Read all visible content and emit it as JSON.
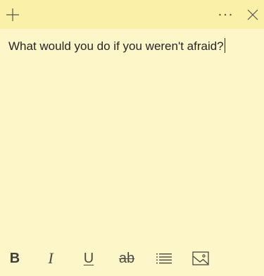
{
  "note": {
    "text": "What would you do if you weren't afraid?",
    "colors": {
      "body": "#fdf6c9",
      "titlebar": "#faf0a7",
      "text": "#262626",
      "icon": "#4a4a45"
    }
  },
  "titlebar": {
    "add_icon": "plus-icon",
    "more_icon": "ellipsis-icon",
    "close_icon": "close-icon"
  },
  "toolbar": {
    "bold_label": "B",
    "italic_label": "I",
    "underline_label": "U",
    "strikethrough_label": "ab",
    "list_icon": "bullet-list-icon",
    "image_icon": "image-icon"
  }
}
